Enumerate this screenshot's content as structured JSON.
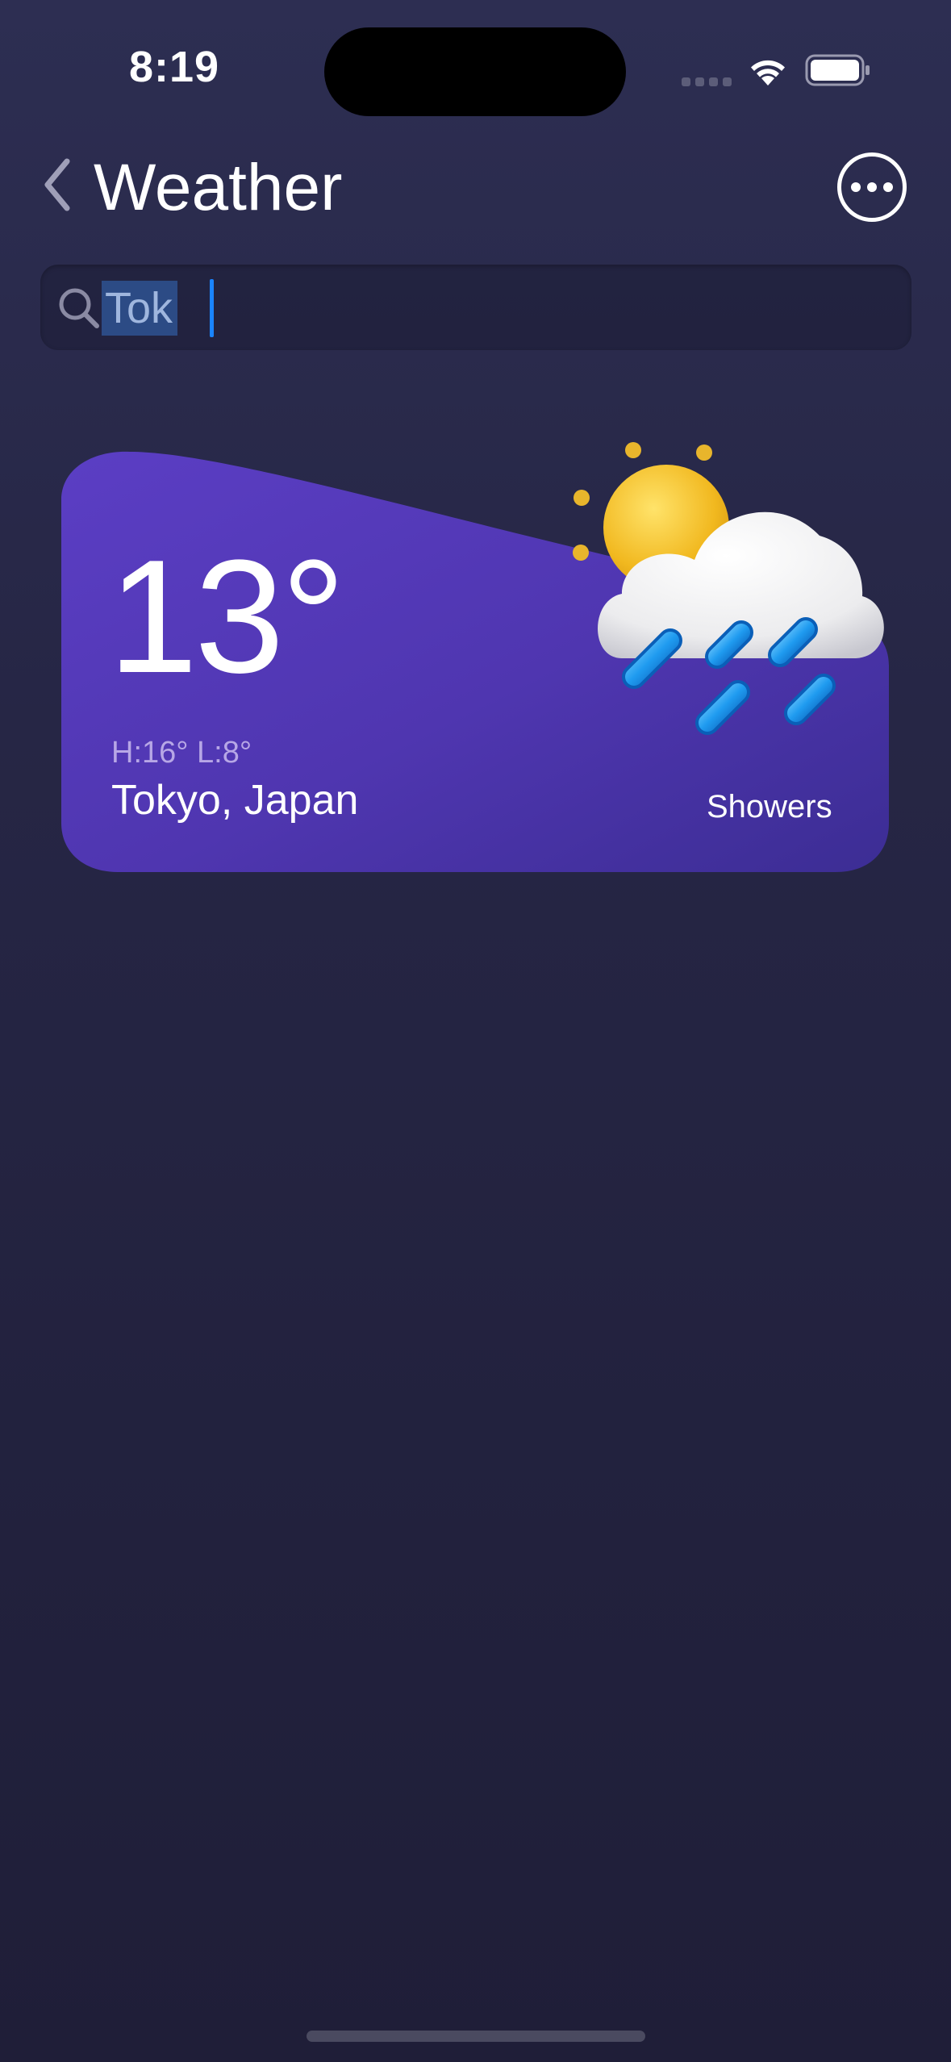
{
  "status_bar": {
    "time": "8:19"
  },
  "nav": {
    "title": "Weather",
    "back_icon": "chevron-left-icon",
    "more_icon": "ellipsis-circle-icon"
  },
  "search": {
    "value": "Tok",
    "icon": "search-icon"
  },
  "weather_card": {
    "temperature": "13°",
    "high_low": "H:16° L:8°",
    "location": "Tokyo, Japan",
    "condition": "Showers",
    "condition_icon": "sun-cloud-rain-icon"
  },
  "colors": {
    "background_top": "#2d2e52",
    "background_bottom": "#1f1e38",
    "card_purple": "#5a3dc0",
    "selection_blue": "#2c4b85",
    "caret_blue": "#1a84ff"
  }
}
